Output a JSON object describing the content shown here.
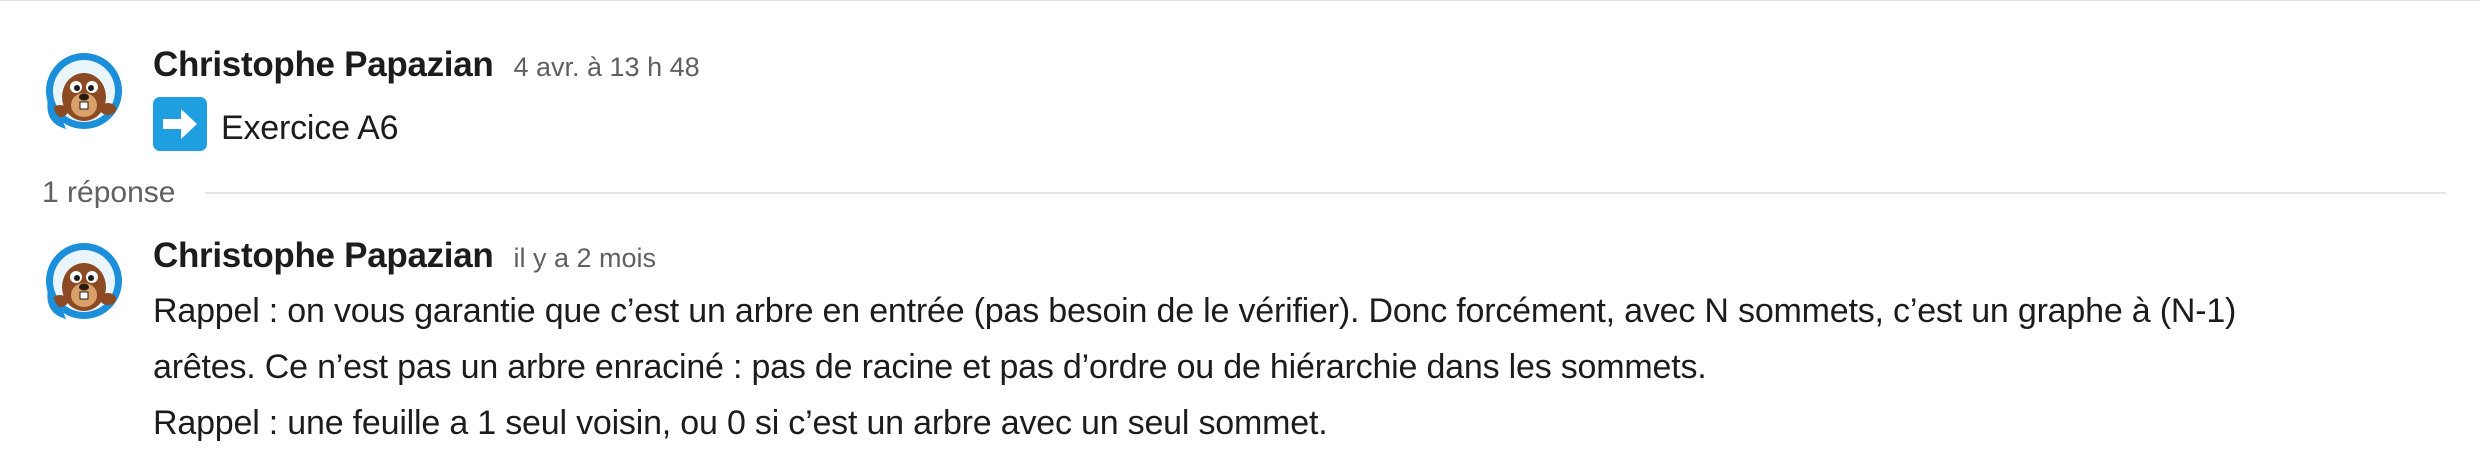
{
  "parent_message": {
    "author": "Christophe Papazian",
    "timestamp": "4 avr. à 13 h 48",
    "emoji": "arrow-right-emoji",
    "text": "Exercice A6"
  },
  "thread": {
    "reply_count_label": "1 réponse"
  },
  "reply_message": {
    "author": "Christophe Papazian",
    "timestamp": "il y a 2 mois",
    "lines": [
      "Rappel : on vous garantie que c’est un arbre en entrée (pas besoin de le vérifier). Donc forcément, avec N sommets, c’est un graphe à (N-1)",
      "arêtes. Ce n’est pas un arbre enraciné : pas de racine et pas d’ordre ou de hiérarchie dans les sommets.",
      "Rappel : une feuille a 1 seul voisin, ou 0 si c’est un arbre avec un seul sommet."
    ]
  },
  "colors": {
    "author_text": "#1d1c1d",
    "timestamp_text": "#616061",
    "emoji_blue": "#1f9fe0",
    "avatar_ring": "#1b8fd9",
    "divider": "#e3e3e3"
  }
}
